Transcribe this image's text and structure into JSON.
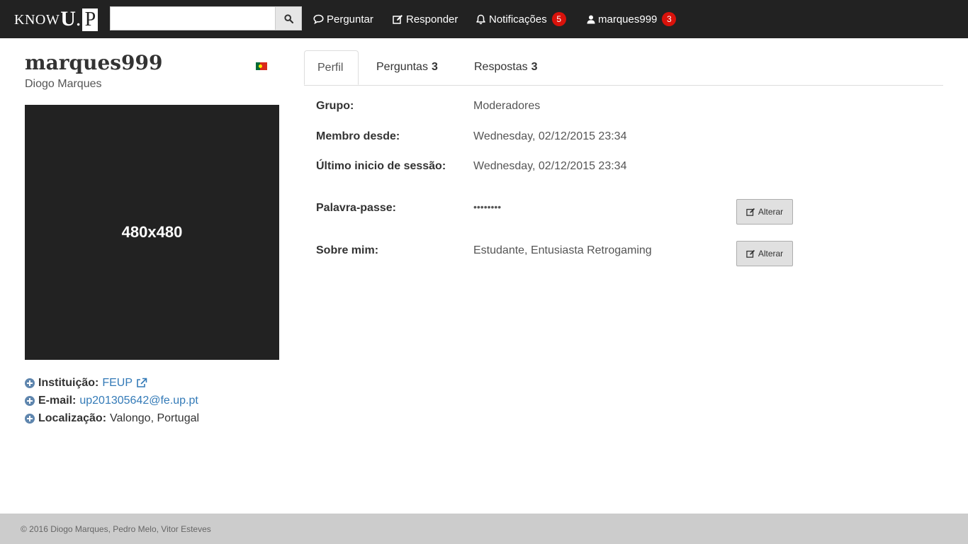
{
  "navbar": {
    "brand": {
      "know": "KNOW",
      "u": "U",
      "dot": ".",
      "p": "P"
    },
    "search": {
      "placeholder": "",
      "button_icon": "search-icon"
    },
    "items": [
      {
        "label": "Perguntar",
        "icon": "comment-icon"
      },
      {
        "label": "Responder",
        "icon": "edit-icon"
      },
      {
        "label": "Notificações",
        "icon": "bell-icon",
        "badge": "5"
      },
      {
        "label": "marques999",
        "icon": "user-icon",
        "badge": "3"
      }
    ],
    "badge_color": "#d9120b",
    "background": "#222222"
  },
  "profile": {
    "username": "marques999",
    "fullname": "Diogo Marques",
    "flag_icon": "portugal-flag-icon",
    "avatar_text": "480x480",
    "info": {
      "institution_label": "Instituição:",
      "institution_value": "FEUP",
      "email_label": "E-mail:",
      "email_value": "up201305642@fe.up.pt",
      "location_label": "Localização:",
      "location_value": "Valongo, Portugal"
    }
  },
  "tabs": [
    {
      "label": "Perfil",
      "count": ""
    },
    {
      "label": "Perguntas",
      "count": "3"
    },
    {
      "label": "Respostas",
      "count": "3"
    }
  ],
  "fields": {
    "group_label": "Grupo:",
    "group_value": "Moderadores",
    "member_since_label": "Membro desde:",
    "member_since_value": "Wednesday, 02/12/2015 23:34",
    "last_login_label": "Último inicio de sessão:",
    "last_login_value": "Wednesday, 02/12/2015 23:34",
    "password_label": "Palavra-passe:",
    "password_value": "••••••••",
    "about_label": "Sobre mim:",
    "about_value": "Estudante, Entusiasta Retrogaming",
    "alter_label": "Alterar"
  },
  "footer": {
    "text": "© 2016 Diogo Marques, Pedro Melo, Vitor Esteves"
  },
  "colors": {
    "link": "#337ab7",
    "footer_bg": "#cccccc"
  }
}
